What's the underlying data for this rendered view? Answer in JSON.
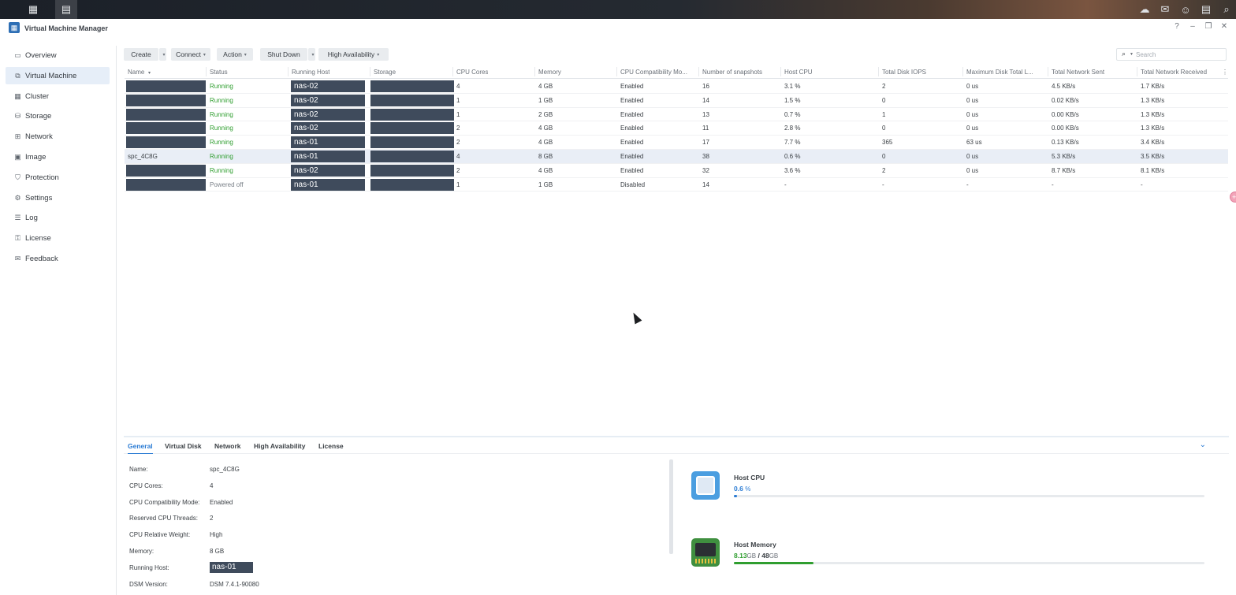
{
  "app": {
    "title": "Virtual Machine Manager"
  },
  "sidebar": {
    "items": [
      {
        "label": "Overview",
        "icon": "overview-icon",
        "glyph": "▭"
      },
      {
        "label": "Virtual Machine",
        "icon": "vm-icon",
        "glyph": "⧉"
      },
      {
        "label": "Cluster",
        "icon": "cluster-icon",
        "glyph": "▦"
      },
      {
        "label": "Storage",
        "icon": "storage-icon",
        "glyph": "⛁"
      },
      {
        "label": "Network",
        "icon": "network-icon",
        "glyph": "⊞"
      },
      {
        "label": "Image",
        "icon": "image-icon",
        "glyph": "▣"
      },
      {
        "label": "Protection",
        "icon": "shield-icon",
        "glyph": "⛉"
      },
      {
        "label": "Settings",
        "icon": "gear-icon",
        "glyph": "⚙"
      },
      {
        "label": "Log",
        "icon": "log-icon",
        "glyph": "☰"
      },
      {
        "label": "License",
        "icon": "key-icon",
        "glyph": "⚿"
      },
      {
        "label": "Feedback",
        "icon": "feedback-icon",
        "glyph": "✉"
      }
    ],
    "active_index": 1
  },
  "toolbar": {
    "create": "Create",
    "connect": "Connect",
    "action": "Action",
    "shutdown": "Shut Down",
    "ha": "High Availability"
  },
  "search": {
    "placeholder": "Search"
  },
  "table": {
    "columns": [
      "Name",
      "Status",
      "Running Host",
      "Storage",
      "CPU Cores",
      "Memory",
      "CPU Compatibility Mo...",
      "Number of snapshots",
      "Host CPU",
      "Total Disk IOPS",
      "Maximum Disk Total L...",
      "Total Network Sent",
      "Total Network Received"
    ],
    "rows": [
      {
        "name": "",
        "status": "Running",
        "host": "nas-02",
        "cores": "4",
        "memory": "4 GB",
        "compat": "Enabled",
        "snapshots": "16",
        "host_cpu": "3.1 %",
        "iops": "2",
        "max_latency": "0 us",
        "net_sent": "4.5 KB/s",
        "net_recv": "1.7 KB/s"
      },
      {
        "name": "",
        "status": "Running",
        "host": "nas-02",
        "cores": "1",
        "memory": "1 GB",
        "compat": "Enabled",
        "snapshots": "14",
        "host_cpu": "1.5 %",
        "iops": "0",
        "max_latency": "0 us",
        "net_sent": "0.02 KB/s",
        "net_recv": "1.3 KB/s"
      },
      {
        "name": "",
        "status": "Running",
        "host": "nas-02",
        "cores": "1",
        "memory": "2 GB",
        "compat": "Enabled",
        "snapshots": "13",
        "host_cpu": "0.7 %",
        "iops": "1",
        "max_latency": "0 us",
        "net_sent": "0.00 KB/s",
        "net_recv": "1.3 KB/s"
      },
      {
        "name": "",
        "status": "Running",
        "host": "nas-02",
        "cores": "2",
        "memory": "4 GB",
        "compat": "Enabled",
        "snapshots": "11",
        "host_cpu": "2.8 %",
        "iops": "0",
        "max_latency": "0 us",
        "net_sent": "0.00 KB/s",
        "net_recv": "1.3 KB/s"
      },
      {
        "name": "",
        "status": "Running",
        "host": "nas-01",
        "cores": "2",
        "memory": "4 GB",
        "compat": "Enabled",
        "snapshots": "17",
        "host_cpu": "7.7 %",
        "iops": "365",
        "max_latency": "63 us",
        "net_sent": "0.13 KB/s",
        "net_recv": "3.4 KB/s"
      },
      {
        "name": "spc_4C8G",
        "status": "Running",
        "host": "nas-01",
        "cores": "4",
        "memory": "8 GB",
        "compat": "Enabled",
        "snapshots": "38",
        "host_cpu": "0.6 %",
        "iops": "0",
        "max_latency": "0 us",
        "net_sent": "5.3 KB/s",
        "net_recv": "3.5 KB/s"
      },
      {
        "name": "",
        "status": "Running",
        "host": "nas-02",
        "cores": "2",
        "memory": "4 GB",
        "compat": "Enabled",
        "snapshots": "32",
        "host_cpu": "3.6 %",
        "iops": "2",
        "max_latency": "0 us",
        "net_sent": "8.7 KB/s",
        "net_recv": "8.1 KB/s"
      },
      {
        "name": "",
        "status": "Powered off",
        "host": "nas-01",
        "cores": "1",
        "memory": "1 GB",
        "compat": "Disabled",
        "snapshots": "14",
        "host_cpu": "-",
        "iops": "-",
        "max_latency": "-",
        "net_sent": "-",
        "net_recv": "-"
      }
    ],
    "selected_index": 5
  },
  "details": {
    "tabs": [
      "General",
      "Virtual Disk",
      "Network",
      "High Availability",
      "License"
    ],
    "active_tab": 0,
    "fields": [
      {
        "label": "Name:",
        "value": "spc_4C8G"
      },
      {
        "label": "CPU Cores:",
        "value": "4"
      },
      {
        "label": "CPU Compatibility Mode:",
        "value": "Enabled"
      },
      {
        "label": "Reserved CPU Threads:",
        "value": "2"
      },
      {
        "label": "CPU Relative Weight:",
        "value": "High"
      },
      {
        "label": "Memory:",
        "value": "8 GB"
      },
      {
        "label": "Running Host:",
        "value": "nas-01"
      },
      {
        "label": "DSM Version:",
        "value": "DSM 7.4.1-90080"
      }
    ],
    "host_cpu": {
      "title": "Host CPU",
      "value": "0.6",
      "unit": "%",
      "percent": 0.6,
      "color": "#2a7bd4"
    },
    "host_memory": {
      "title": "Host Memory",
      "used": "8.13",
      "used_unit": "GB",
      "sep": "/",
      "total": "48",
      "total_unit": "GB",
      "percent": 16.9,
      "color": "#2f9e2f"
    }
  }
}
